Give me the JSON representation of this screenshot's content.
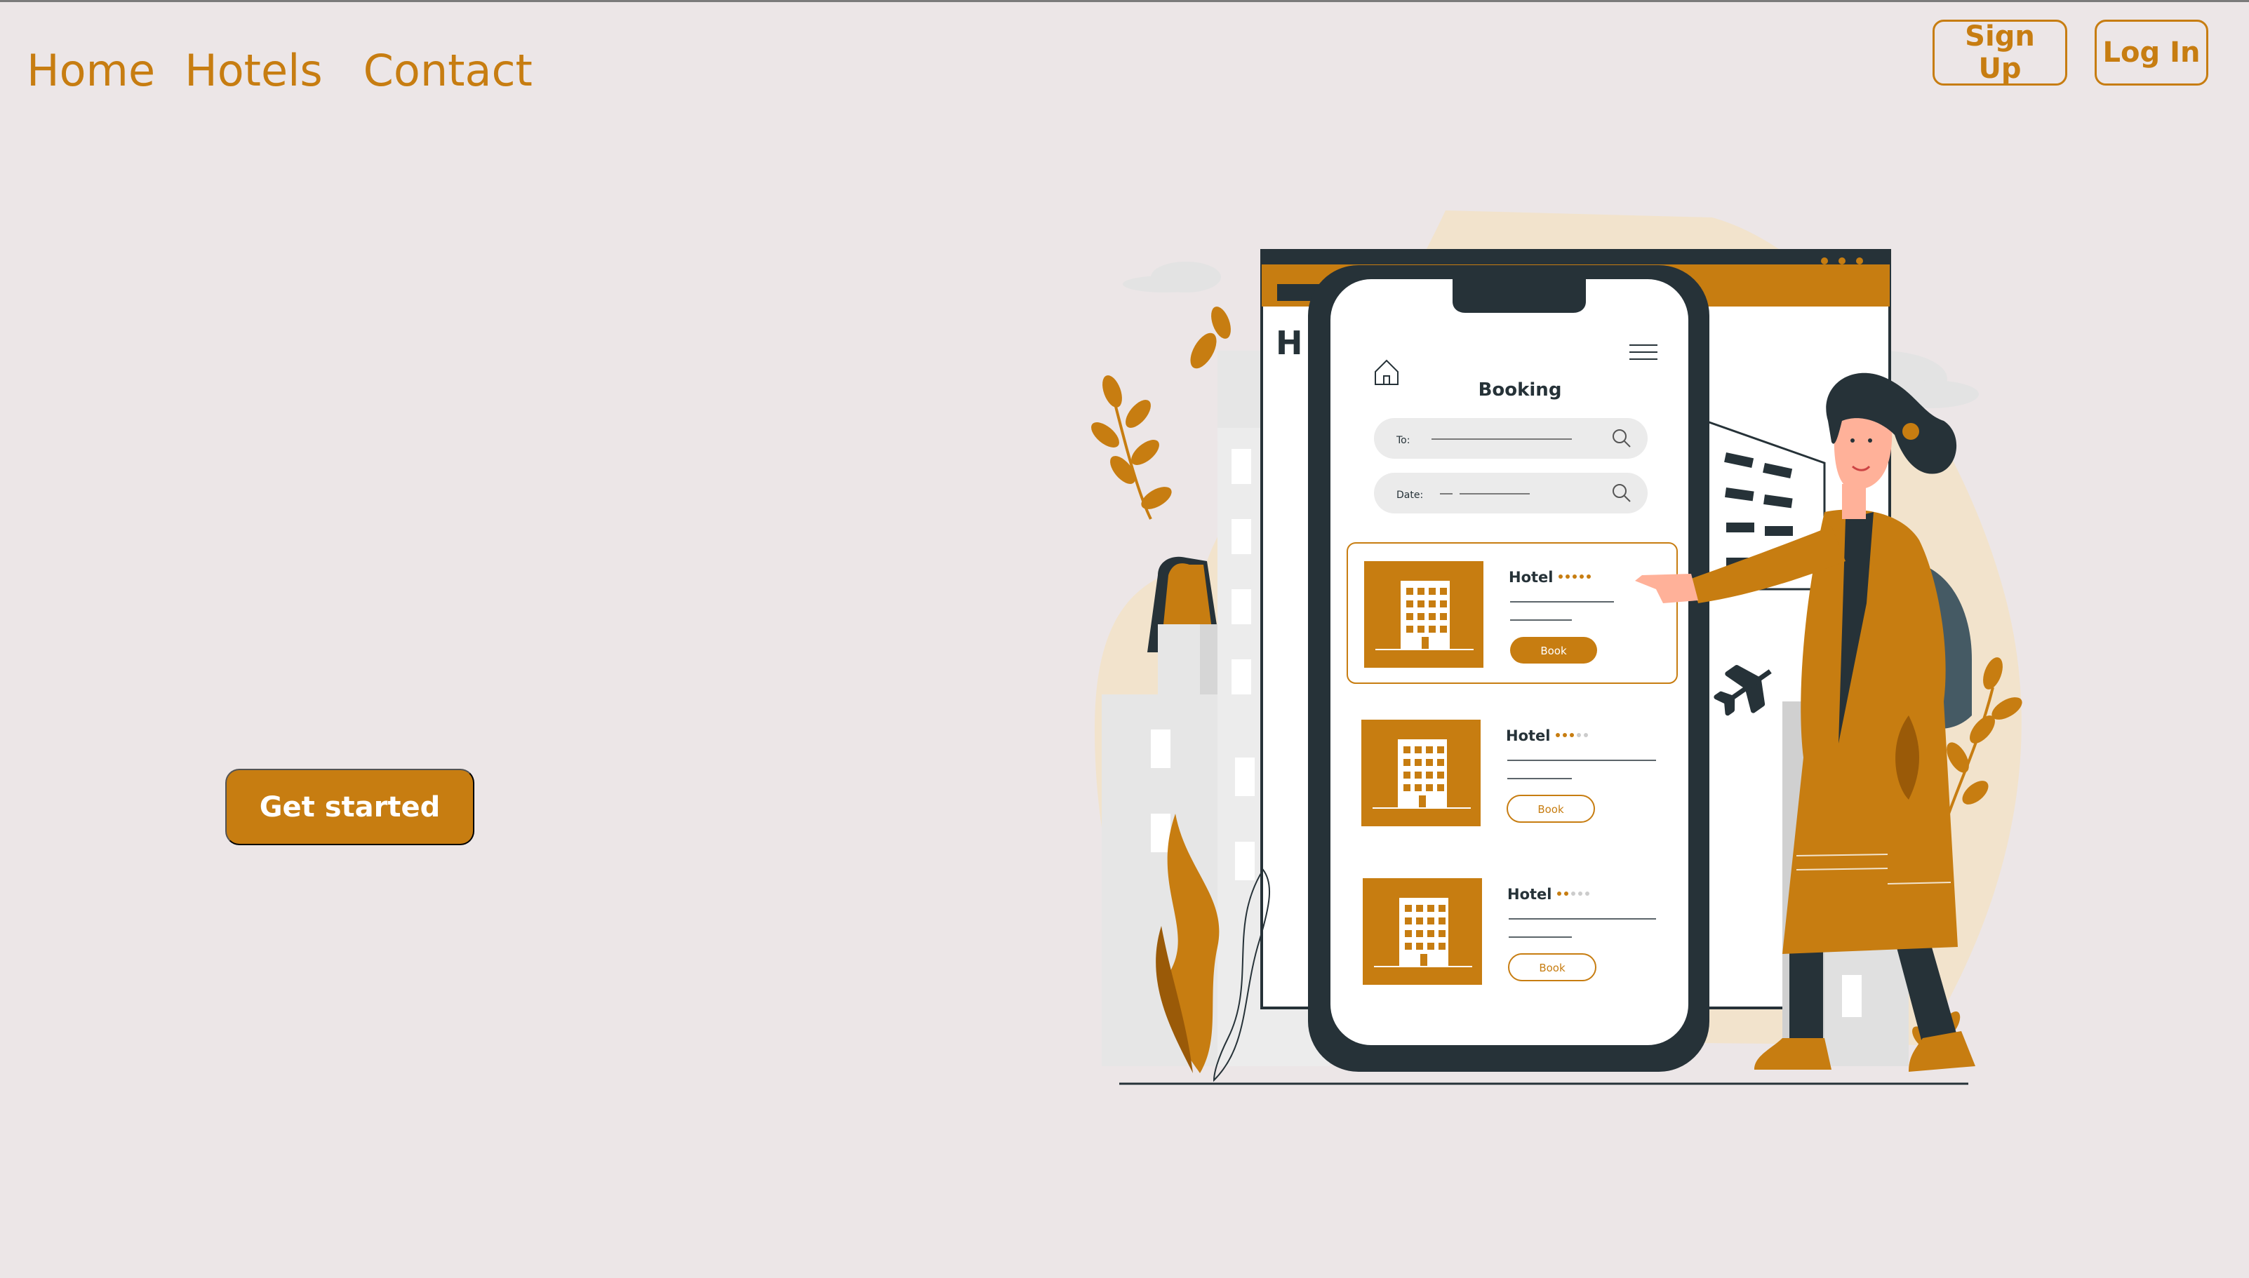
{
  "nav": {
    "home": "Home",
    "hotels": "Hotels",
    "contact": "Contact"
  },
  "auth": {
    "signup": "Sign Up",
    "login": "Log In"
  },
  "hero": {
    "cta": "Get started"
  },
  "illustration": {
    "screen_title": "Booking",
    "field_to": "To:",
    "field_date": "Date:",
    "sign_partial": "H",
    "cards": [
      {
        "title": "Hotel",
        "stars": 5,
        "button": "Book"
      },
      {
        "title": "Hotel",
        "stars": 3,
        "button": "Book"
      },
      {
        "title": "Hotel",
        "stars": 2,
        "button": "Book"
      }
    ]
  },
  "colors": {
    "accent": "#c77d11",
    "background": "#ece6e7",
    "dark": "#263238"
  }
}
